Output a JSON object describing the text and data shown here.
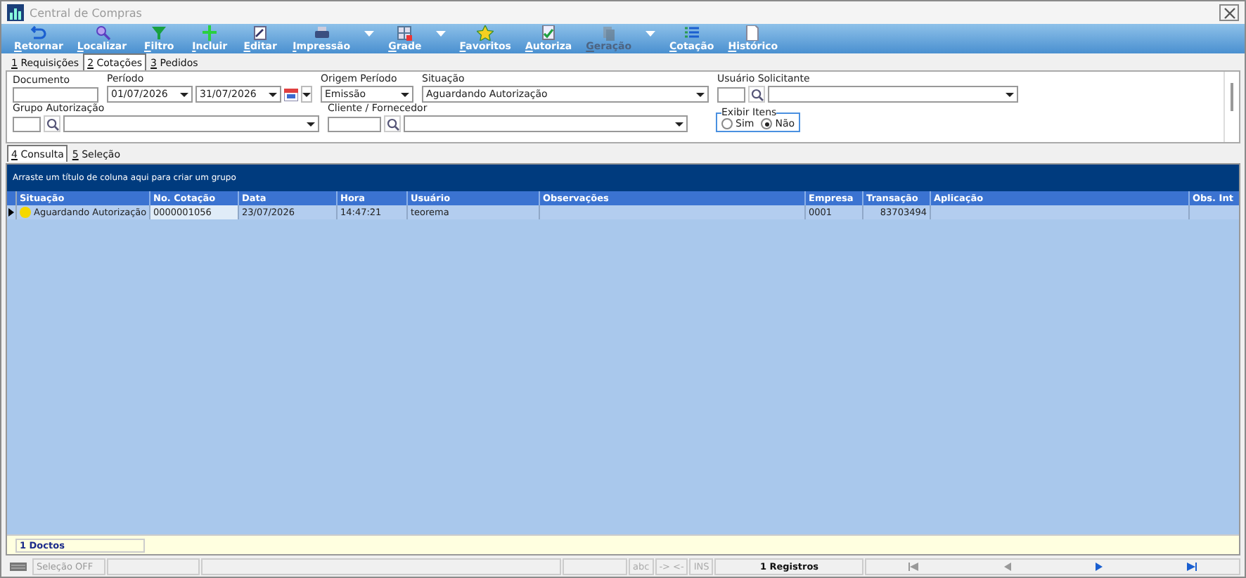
{
  "window": {
    "title": "Central de Compras"
  },
  "toolbar": [
    {
      "label": "Retornar",
      "disabled": false,
      "dropdown": false
    },
    {
      "label": "Localizar",
      "disabled": false,
      "dropdown": false
    },
    {
      "label": "Filtro",
      "disabled": false,
      "dropdown": false
    },
    {
      "label": "Incluir",
      "disabled": false,
      "dropdown": false
    },
    {
      "label": "Editar",
      "disabled": false,
      "dropdown": false
    },
    {
      "label": "Impressão",
      "disabled": false,
      "dropdown": true
    },
    {
      "label": "Grade",
      "disabled": false,
      "dropdown": true
    },
    {
      "label": "Favoritos",
      "disabled": false,
      "dropdown": false
    },
    {
      "label": "Autoriza",
      "disabled": false,
      "dropdown": false
    },
    {
      "label": "Geração",
      "disabled": true,
      "dropdown": true
    },
    {
      "label": "Cotação",
      "disabled": false,
      "dropdown": false
    },
    {
      "label": "Histórico",
      "disabled": false,
      "dropdown": false
    }
  ],
  "tabs": [
    {
      "key": "1",
      "label": " Requisições",
      "selected": false
    },
    {
      "key": "2",
      "label": " Cotações",
      "selected": true
    },
    {
      "key": "3",
      "label": " Pedidos",
      "selected": false
    }
  ],
  "filters": {
    "documento": {
      "label": "Documento"
    },
    "periodo": {
      "label": "Período",
      "from": "01/07/2026",
      "to": "31/07/2026"
    },
    "origem": {
      "label": "Origem Período",
      "value": "Emissão"
    },
    "situacao": {
      "label": "Situação",
      "value": "Aguardando Autorização"
    },
    "usuario": {
      "label": "Usuário Solicitante"
    },
    "grupo": {
      "label": "Grupo Autorização"
    },
    "cliente": {
      "label": "Cliente / Fornecedor"
    },
    "exibir": {
      "label": "Exibir Itens",
      "options": [
        {
          "label": "Sim",
          "selected": false
        },
        {
          "label": "Não",
          "selected": true
        }
      ]
    }
  },
  "subtabs": [
    {
      "key": "4",
      "label": " Consulta",
      "selected": true
    },
    {
      "key": "5",
      "label": " Seleção",
      "selected": false
    }
  ],
  "grid": {
    "group_hint": "Arraste um título de coluna aqui para criar um grupo",
    "columns": [
      "Situação",
      "No. Cotação",
      "Data",
      "Hora",
      "Usuário",
      "Observações",
      "Empresa",
      "Transação",
      "Aplicação",
      "Obs. Int"
    ],
    "rows": [
      {
        "current": true,
        "color": "#f5d800",
        "cells": [
          "Aguardando Autorização",
          "0000001056",
          "23/07/2026",
          "14:47:21",
          "teorema",
          null,
          "0001",
          "83703494",
          null,
          null
        ]
      }
    ],
    "footer": "1 Doctos"
  },
  "status_bar": {
    "selection": "Seleção OFF",
    "abc": "abc",
    "arrows": "-> <-",
    "ins": "INS",
    "records": "1 Registros"
  }
}
